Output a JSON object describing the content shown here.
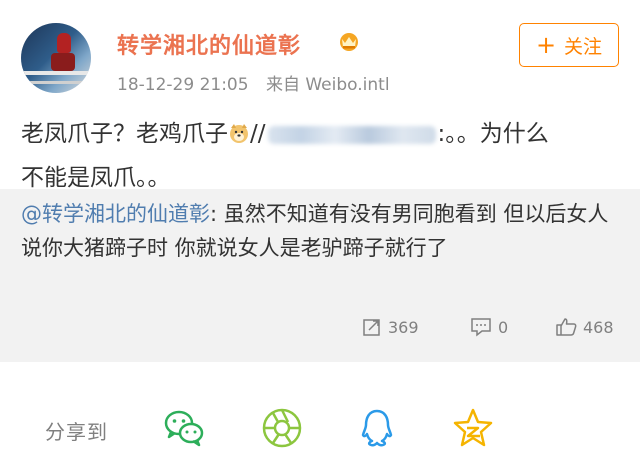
{
  "user": {
    "name": "转学湘北的仙道彰",
    "timestamp": "18-12-29 21:05",
    "source": "来自 Weibo.intl",
    "badge_icon": "crown-icon"
  },
  "follow_button": {
    "plus": "+",
    "label": "关注"
  },
  "post": {
    "text_a": "老凤爪子？老鸡爪子",
    "sep": "//",
    "text_b": ":。。为什么",
    "line2": "不能是凤爪。。"
  },
  "repost": {
    "mention": "@转学湘北的仙道彰",
    "text": ": 虽然不知道有没有男同胞看到 但以后女人说你大猪蹄子时 你就说女人是老驴蹄子就行了"
  },
  "stats": {
    "reposts": "369",
    "comments": "0",
    "likes": "468"
  },
  "share": {
    "label": "分享到",
    "targets": [
      "wechat-icon",
      "moments-icon",
      "qq-icon",
      "qzone-icon"
    ]
  },
  "colors": {
    "username": "#eb7350",
    "follow": "#ff8200",
    "mention": "#507daf",
    "repost_bg": "#f2f2f2"
  }
}
